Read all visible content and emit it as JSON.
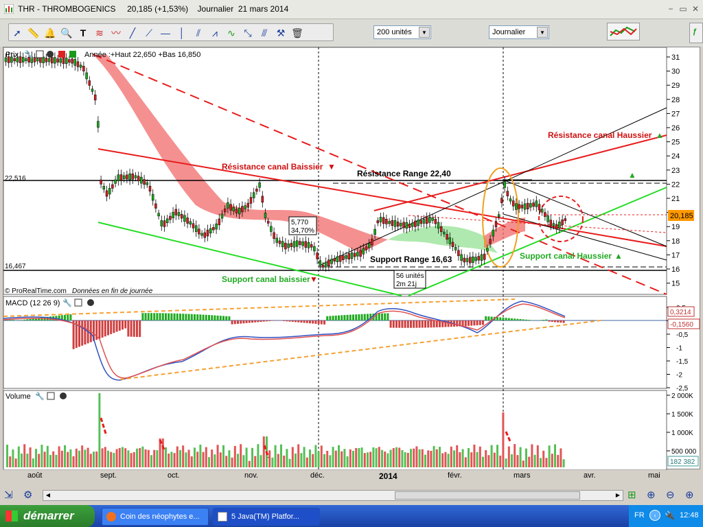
{
  "window": {
    "title": "THR - THROMBOGENICS     20,185 (+1,53%)    Journalier  21 mars 2014",
    "buttons": [
      "−",
      "▭",
      "✕"
    ]
  },
  "toolbar": {
    "units_select": "200 unités",
    "period_select": "Journalier"
  },
  "price_panel": {
    "label": "Prix",
    "info": "Année :+Haut 22,650 +Bas 16,850",
    "left_level_high": "22,516",
    "left_level_low": "16,467",
    "current_price": "20,185",
    "annotations": {
      "res_baissier": "Résistance canal Baissier",
      "res_range": "Résistance Range 22,40",
      "res_haussier": "Résistance canal Haussier",
      "sup_range": "Support Range 16,63",
      "sup_haussier": "Support canal Haussier",
      "sup_baissier": "Support canal baissier",
      "box1_line1": "5,770",
      "box1_line2": "34,70%",
      "box2_line1": "56 unités",
      "box2_line2": "2m 21j"
    },
    "credit": "© ProRealTime.com",
    "credit_note": "Données en fin de journée",
    "y_ticks": [
      "31",
      "30",
      "29",
      "28",
      "27",
      "26",
      "25",
      "24",
      "23",
      "22",
      "21",
      "20",
      "19",
      "18",
      "17",
      "16",
      "15"
    ]
  },
  "macd_panel": {
    "label": "MACD (12 26 9)",
    "value1": "0,3214",
    "value2": "-0,1560",
    "y_ticks": [
      "0,5",
      "0",
      "-0,5",
      "-1",
      "-1,5",
      "-2",
      "-2,5"
    ]
  },
  "volume_panel": {
    "label": "Volume",
    "current": "182 382",
    "y_ticks": [
      "2 000K",
      "1 500K",
      "1 000K",
      "500 000"
    ]
  },
  "x_axis": {
    "labels": [
      "août",
      "sept.",
      "oct.",
      "nov.",
      "déc.",
      "2014",
      "févr.",
      "mars",
      "avr.",
      "mai"
    ]
  },
  "colors": {
    "red": "#e81c1c",
    "green": "#22dd22",
    "price_badge": "#ff9900"
  },
  "taskbar": {
    "start": "démarrer",
    "task1": "Coin des néophytes e...",
    "task2": "5 Java(TM) Platfor...",
    "lang": "FR",
    "time": "12:48"
  }
}
